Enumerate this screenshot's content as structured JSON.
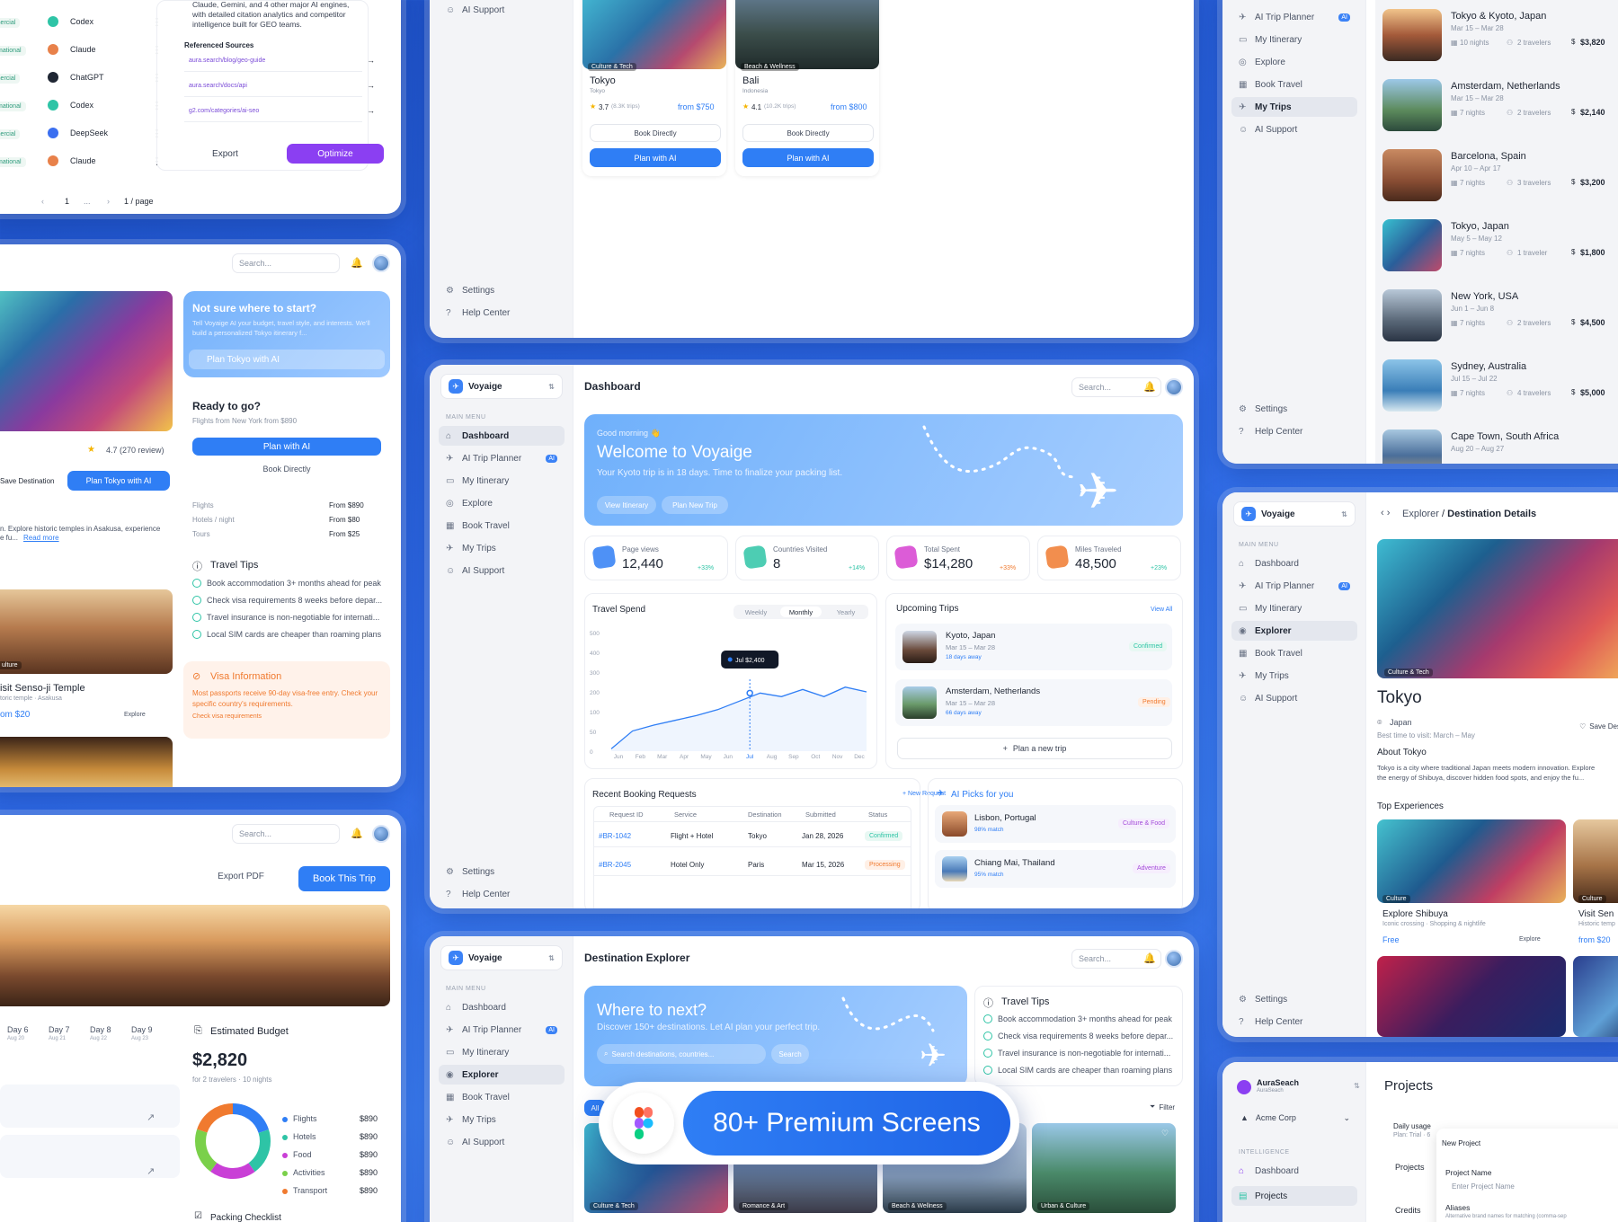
{
  "brand": "Voyaige",
  "common": {
    "search": "Search...",
    "main_menu": "MAIN MENU",
    "settings": "Settings",
    "help": "Help Center"
  },
  "nav": [
    "Dashboard",
    "AI Trip Planner",
    "My Itinerary",
    "Explore",
    "Book Travel",
    "My Trips",
    "AI Support"
  ],
  "nav2": [
    "Dashboard",
    "AI Trip Planner",
    "My Itinerary",
    "Explorer",
    "Book Travel",
    "My Trips",
    "AI Support"
  ],
  "ai_badge": "AI",
  "colors": {
    "primary": "#2f7ef5",
    "purple": "#8b3ff2",
    "orange": "#f07a2f",
    "green": "#2ec4a6",
    "pink": "#d63fd0"
  },
  "optimizer": {
    "intro": "Claude, Gemini, and 4 other major AI engines, with detailed citation analytics and competitor intelligence built for GEO teams.",
    "ref_title": "Referenced Sources",
    "sources": [
      "aura.search/blog/geo-guide",
      "aura.search/docs/api",
      "g2.com/categories/ai-seo"
    ],
    "export": "Export",
    "optimize": "Optimize",
    "rows": [
      {
        "tag": "ommercial",
        "engine": "Codex"
      },
      {
        "tag": "nformational",
        "engine": "Claude"
      },
      {
        "tag": "ommercial",
        "engine": "ChatGPT"
      },
      {
        "tag": "nformational",
        "engine": "Codex"
      },
      {
        "tag": "ommercial",
        "engine": "DeepSeek"
      },
      {
        "tag": "nformational",
        "engine": "Claude"
      }
    ],
    "pager": {
      "page": "1",
      "dots": "...",
      "per": "1 / page"
    }
  },
  "tokyo_side": {
    "cta_title": "Not sure where to start?",
    "cta_text": "Tell Voyaige AI your budget, travel style, and interests. We'll build a personalized Tokyo itinerary f...",
    "cta_btn": "Plan Tokyo with AI",
    "ready": "Ready to go?",
    "flights_from": "Flights from New York from $890",
    "plan_ai": "Plan with AI",
    "book": "Book Directly",
    "prices": [
      {
        "k": "Flights",
        "v": "From $890"
      },
      {
        "k": "Hotels / night",
        "v": "From $80"
      },
      {
        "k": "Tours",
        "v": "From $25"
      }
    ],
    "rating": "4.7 (270 review)",
    "save": "Save Destination",
    "plan_tokyo": "Plan Tokyo with AI",
    "desc": "n. Explore historic temples in Asakusa, experience",
    "desc2": "e fu...",
    "read_more": "Read more",
    "tips_title": "Travel Tips",
    "tips": [
      "Book accommodation 3+ months ahead for peak",
      "Check visa requirements 8 weeks before depar...",
      "Travel insurance is non-negotiable for internati...",
      "Local SIM cards are cheaper than roaming plans"
    ],
    "visa_title": "Visa Information",
    "visa_text": "Most passports receive 90-day visa-free entry. Check your specific country's requirements.",
    "visa_link": "Check visa requirements",
    "temple": "isit Senso-ji Temple",
    "temple_sub": "toric temple · Asakusa",
    "temple_price": "om $20",
    "explore": "Explore",
    "culture": "ulture"
  },
  "itinerary": {
    "export_pdf": "Export PDF",
    "book_trip": "Book This Trip",
    "days": [
      {
        "d": "Day 6",
        "date": "Aug 20"
      },
      {
        "d": "Day 7",
        "date": "Aug 21"
      },
      {
        "d": "Day 8",
        "date": "Aug 22"
      },
      {
        "d": "Day 9",
        "date": "Aug 23"
      }
    ],
    "budget_title": "Estimated Budget",
    "budget": "$2,820",
    "budget_sub": "for 2 travelers · 10 nights",
    "breakdown": [
      {
        "k": "Flights",
        "v": "$890",
        "c": "#2f7ef5"
      },
      {
        "k": "Hotels",
        "v": "$890",
        "c": "#2ec4a6"
      },
      {
        "k": "Food",
        "v": "$890",
        "c": "#c93fd6"
      },
      {
        "k": "Activities",
        "v": "$890",
        "c": "#7ad04a"
      },
      {
        "k": "Transport",
        "v": "$890",
        "c": "#f07a2f"
      }
    ],
    "packing": "Packing Checklist"
  },
  "top_dest": {
    "cards": [
      {
        "city": "Tokyo",
        "sub": "Tokyo",
        "rating": "3.7",
        "reviews": "(8.3K trips)",
        "price": "from $750",
        "tag": "Culture & Tech"
      },
      {
        "city": "Bali",
        "sub": "Indonesia",
        "rating": "4.1",
        "reviews": "(10.2K trips)",
        "price": "from $800",
        "tag": "Beach & Wellness"
      }
    ],
    "book": "Book Directly",
    "plan": "Plan with AI",
    "ai_support": "AI Support"
  },
  "dashboard": {
    "title": "Dashboard",
    "greet": "Good morning 👋",
    "welcome": "Welcome to  Voyaige",
    "welcome_sub": "Your Kyoto trip is in 18 days. Time to finalize your packing list.",
    "view_itin": "View Itinerary",
    "plan_new": "Plan New Trip",
    "stats": [
      {
        "label": "Page views",
        "value": "12,440",
        "delta": "+33%",
        "color": "#2f7ef5"
      },
      {
        "label": "Countries Visited",
        "value": "8",
        "delta": "+14%",
        "color": "#2ec4a6"
      },
      {
        "label": "Total Spent",
        "value": "$14,280",
        "delta": "+33%",
        "color": "#d63fd0"
      },
      {
        "label": "Miles Traveled",
        "value": "48,500",
        "delta": "+23%",
        "color": "#f07a2f"
      }
    ],
    "spend_title": "Travel Spend",
    "tabs": [
      "Weekly",
      "Monthly",
      "Yearly"
    ],
    "upcoming_title": "Upcoming Trips",
    "view_all": "View All",
    "upcoming": [
      {
        "city": "Kyoto, Japan",
        "dates": "Mar 15 – Mar 28",
        "away": "18 days away",
        "status": "Confirmed"
      },
      {
        "city": "Amsterdam, Netherlands",
        "dates": "Mar 15 – Mar 28",
        "away": "66 days away",
        "status": "Pending"
      }
    ],
    "plan_trip": "Plan a new trip",
    "req_title": "Recent Booking Requests",
    "new_req": "New Request",
    "req_cols": [
      "Request ID",
      "Service",
      "Destination",
      "Submitted",
      "Status"
    ],
    "requests": [
      {
        "id": "#BR-1042",
        "service": "Flight + Hotel",
        "dest": "Tokyo",
        "date": "Jan 28, 2026",
        "status": "Confirmed"
      },
      {
        "id": "#BR-2045",
        "service": "Hotel Only",
        "dest": "Paris",
        "date": "Mar 15, 2026",
        "status": "Processing"
      }
    ],
    "picks_title": "AI Picks for you",
    "picks": [
      {
        "city": "Lisbon, Portugal",
        "match": "98% match",
        "tag": "Culture & Food"
      },
      {
        "city": "Chiang Mai, Thailand",
        "match": "95% match",
        "tag": "Adventure"
      }
    ]
  },
  "chart_data": {
    "type": "line",
    "title": "Travel Spend",
    "categories": [
      "Jun",
      "Feb",
      "Mar",
      "Apr",
      "May",
      "Jun",
      "Jul",
      "Aug",
      "Sep",
      "Oct",
      "Nov",
      "Dec"
    ],
    "values": [
      10,
      85,
      110,
      130,
      150,
      175,
      210,
      245,
      230,
      260,
      230,
      270,
      250
    ],
    "ylim": [
      0,
      500
    ],
    "yticks": [
      "500",
      "400",
      "300",
      "200",
      "100",
      "50",
      "0"
    ],
    "tooltip": {
      "label": "Jul",
      "value": "$2,400"
    }
  },
  "explorer": {
    "title": "Destination Explorer",
    "hero": "Where to next?",
    "hero_sub": "Discover 150+ destinations. Let AI plan your perfect trip.",
    "search_ph": "Search destinations, countries...",
    "search_btn": "Search",
    "filter": "Filter",
    "tips_title": "Travel Tips",
    "tags": [
      "Culture & Tech",
      "Romance & Art",
      "Beach & Wellness",
      "Urban & Culture"
    ],
    "all": "All"
  },
  "promo": {
    "label": "80+ Premium Screens"
  },
  "mytrips": {
    "trips": [
      {
        "city": "Tokyo & Kyoto, Japan",
        "dates": "Mar 15 – Mar 28",
        "nights": "10 nights",
        "travelers": "2 travelers",
        "price": "$3,820"
      },
      {
        "city": "Amsterdam, Netherlands",
        "dates": "Mar 15 – Mar 28",
        "nights": "7 nights",
        "travelers": "2 travelers",
        "price": "$2,140"
      },
      {
        "city": "Barcelona, Spain",
        "dates": "Apr 10 – Apr 17",
        "nights": "7 nights",
        "travelers": "3 travelers",
        "price": "$3,200"
      },
      {
        "city": "Tokyo, Japan",
        "dates": "May 5 – May 12",
        "nights": "7 nights",
        "travelers": "1 traveler",
        "price": "$1,800"
      },
      {
        "city": "New York, USA",
        "dates": "Jun 1 – Jun 8",
        "nights": "7 nights",
        "travelers": "2 travelers",
        "price": "$4,500"
      },
      {
        "city": "Sydney, Australia",
        "dates": "Jul 15 – Jul 22",
        "nights": "7 nights",
        "travelers": "4 travelers",
        "price": "$5,000"
      },
      {
        "city": "Cape Town, South Africa",
        "dates": "Aug 20 – Aug 27",
        "nights": "",
        "travelers": "",
        "price": ""
      }
    ]
  },
  "details": {
    "crumb1": "Explorer",
    "crumb2": "Destination Details",
    "city": "Tokyo",
    "country": "Japan",
    "best": "Best time to visit: March – May",
    "save": "Save Des",
    "about_title": "About Tokyo",
    "about": "Tokyo is a city where traditional Japan meets modern innovation. Explore",
    "about2": "the energy of Shibuya, discover hidden food spots, and enjoy the fu...",
    "re": "Re",
    "top_exp": "Top Experiences",
    "exp": [
      {
        "t": "Explore Shibuya",
        "s": "Iconic crossing · Shopping & nightlife",
        "p": "Free",
        "tag": "Culture"
      },
      {
        "t": "Visit Sen",
        "s": "Historic temp",
        "p": "from $20",
        "tag": "Culture"
      }
    ],
    "explore": "Explore",
    "culture": "Culture & Tech"
  },
  "aura": {
    "brand": "AuraSeach",
    "sub": "AuraSeach",
    "org": "Acme Corp",
    "intel": "INTELLIGENCE",
    "nav": [
      "Dashboard",
      "Projects"
    ],
    "title": "Projects",
    "usage": "Daily usage",
    "plan": "Plan: Trial · 6",
    "projects": "Projects",
    "credits": "Credits",
    "modal_title": "New Project",
    "name_label": "Project Name",
    "name_ph": "Enter Project Name",
    "aliases": "Aliases",
    "aliases_sub": "Alternative brand names for matching (comma-sep"
  }
}
